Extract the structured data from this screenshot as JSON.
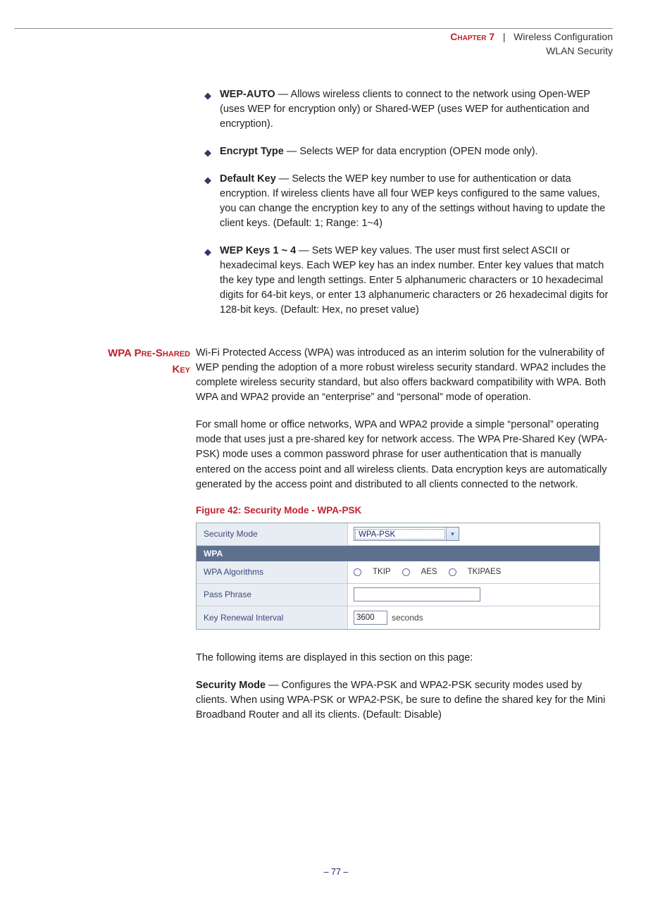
{
  "header": {
    "chapter_label": "Chapter 7",
    "separator": "|",
    "chapter_title": "Wireless Configuration",
    "subhead": "WLAN Security"
  },
  "bullets": [
    {
      "term": "WEP-AUTO",
      "body": " — Allows wireless clients to connect to the network using Open-WEP (uses WEP for encryption only) or Shared-WEP (uses WEP for authentication and encryption)."
    },
    {
      "term": "Encrypt Type",
      "body": " — Selects WEP for data encryption (OPEN mode only)."
    },
    {
      "term": "Default Key",
      "body": " — Selects the WEP key number to use for authentication or data encryption. If wireless clients have all four WEP keys configured to the same values, you can change the encryption key to any of the settings without having to update the client keys. (Default: 1; Range: 1~4)"
    },
    {
      "term": "WEP Keys 1 ~ 4",
      "body": " — Sets WEP key values. The user must first select ASCII or hexadecimal keys. Each WEP key has an index number. Enter key values that match the key type and length settings. Enter 5 alphanumeric characters or 10 hexadecimal digits for 64-bit keys, or enter 13 alphanumeric characters or 26 hexadecimal digits for 128-bit keys. (Default: Hex, no preset value)"
    }
  ],
  "section": {
    "side_heading_line1": "WPA Pre-Shared",
    "side_heading_line2": "Key",
    "para1": "Wi-Fi Protected Access (WPA) was introduced as an interim solution for the vulnerability of WEP pending the adoption of a more robust wireless security standard. WPA2 includes the complete wireless security standard, but also offers backward compatibility with WPA. Both WPA and WPA2 provide an “enterprise” and “personal” mode of operation.",
    "para2": "For small home or office networks, WPA and WPA2 provide a simple “personal” operating mode that uses just a pre-shared key for network access. The WPA Pre-Shared Key (WPA-PSK) mode uses a common password phrase for user authentication that is manually entered on the access point and all wireless clients. Data encryption keys are automatically generated by the access point and distributed to all clients connected to the network."
  },
  "figure": {
    "caption": "Figure 42:  Security Mode - WPA-PSK",
    "security_mode_label": "Security Mode",
    "security_mode_value": "WPA-PSK",
    "section_header": "WPA",
    "rows": {
      "algo_label": "WPA Algorithms",
      "algo_options": [
        "TKIP",
        "AES",
        "TKIPAES"
      ],
      "pass_label": "Pass Phrase",
      "renew_label": "Key Renewal Interval",
      "renew_value": "3600",
      "renew_unit": "seconds"
    }
  },
  "after_figure": {
    "intro": "The following items are displayed in this section on this page:",
    "item_term": "Security Mode",
    "item_body": " — Configures the WPA-PSK and WPA2-PSK security modes used by clients. When using WPA-PSK or WPA2-PSK, be sure to define the shared key for the Mini Broadband Router and all its clients. (Default: Disable)"
  },
  "page_number": "–  77  –"
}
